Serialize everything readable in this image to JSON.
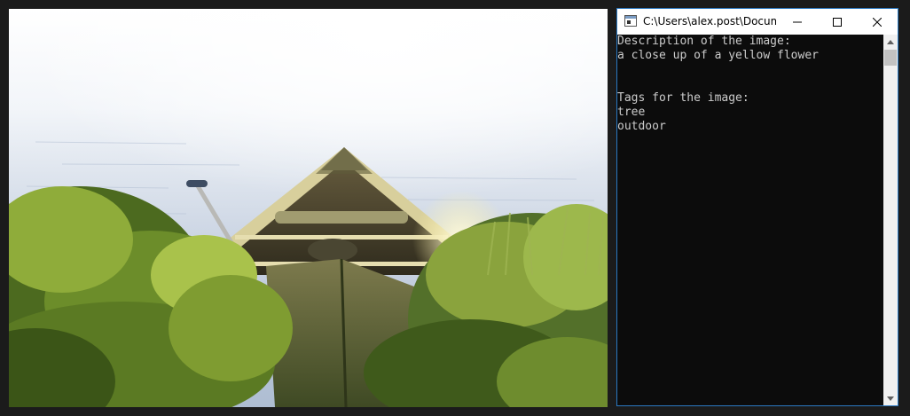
{
  "photo": {
    "icon": "canoe-photo"
  },
  "console": {
    "title": "C:\\Users\\alex.post\\Docum...",
    "controls": {
      "minimize_icon": "minimize-icon",
      "maximize_icon": "maximize-icon",
      "close_icon": "close-icon"
    },
    "lines": [
      "Description of the image:",
      "a close up of a yellow flower",
      "",
      "",
      "Tags for the image:",
      "tree",
      "outdoor"
    ],
    "colors": {
      "background": "#0c0c0c",
      "text": "#cccccc",
      "border": "#2b79c2"
    }
  }
}
